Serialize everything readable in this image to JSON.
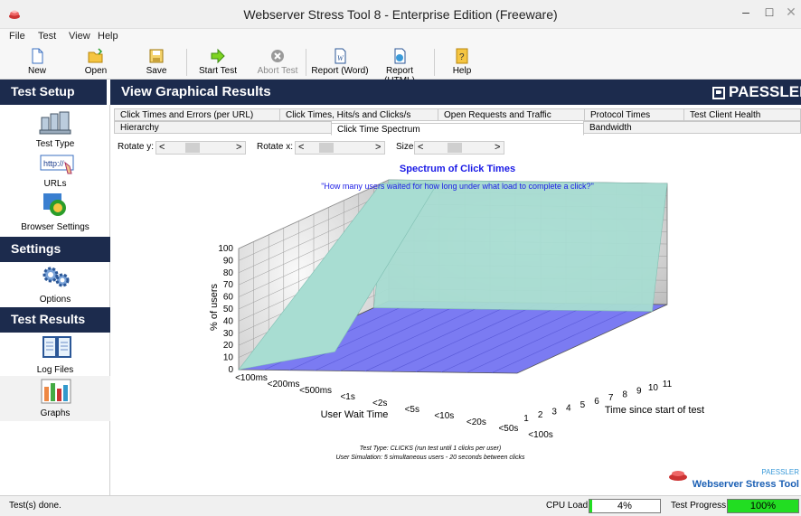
{
  "window": {
    "title": "Webserver Stress Tool 8 - Enterprise Edition (Freeware)"
  },
  "menu": [
    "File",
    "Test",
    "View",
    "Help"
  ],
  "toolbar": {
    "new": "New",
    "open": "Open",
    "save": "Save",
    "start_test": "Start Test",
    "abort_test": "Abort Test",
    "report_word": "Report (Word)",
    "report_html": "Report (HTML)",
    "help": "Help"
  },
  "header": {
    "left": "Test Setup",
    "main": "View Graphical Results",
    "logo": "PAESSLER"
  },
  "sidebar": {
    "test_type": "Test Type",
    "urls": "URLs",
    "browser_settings": "Browser Settings",
    "settings": "Settings",
    "options": "Options",
    "test_results": "Test Results",
    "log_files": "Log Files",
    "graphs": "Graphs",
    "url_icon_text": "http://"
  },
  "tabs": {
    "row1": [
      "Click Times and Errors (per URL)",
      "Click Times, Hits/s and Clicks/s",
      "Open Requests and Traffic",
      "Protocol Times",
      "Test Client Health"
    ],
    "row2": [
      "Hierarchy",
      "Click Time Spectrum",
      "Bandwidth"
    ],
    "active": "Click Time Spectrum"
  },
  "rotate": {
    "rotate_y": "Rotate y:",
    "rotate_x": "Rotate x:",
    "size": "Size:",
    "left": "<",
    "right": ">"
  },
  "chart_data": {
    "type": "area",
    "title": "Spectrum of Click Times",
    "subtitle": "\"How many users waited for how long under what load to complete a click?\"",
    "ylabel": "% of users",
    "xlabel": "User Wait Time",
    "zlabel": "Time since start of test",
    "y_ticks": [
      "0",
      "10",
      "20",
      "30",
      "40",
      "50",
      "60",
      "70",
      "80",
      "90",
      "100"
    ],
    "x_ticks": [
      "<100ms",
      "<200ms",
      "<500ms",
      "<1s",
      "<2s",
      "<5s",
      "<10s",
      "<20s",
      "<50s",
      "<100s"
    ],
    "z_ticks": [
      "1",
      "2",
      "3",
      "4",
      "5",
      "6",
      "7",
      "8",
      "9",
      "10",
      "11"
    ],
    "ylim": [
      0,
      100
    ],
    "series": [
      {
        "values": [
          100,
          0,
          0,
          0,
          0,
          0,
          0,
          0,
          0,
          0
        ],
        "color": "#a8ddd2"
      }
    ],
    "floor_color": "#7b7bf2",
    "footnote1": "Test Type: CLICKS (run test until 1 clicks per user)",
    "footnote2": "User Simulation: 5 simultaneous users - 20 seconds between clicks",
    "brand_small": "PAESSLER",
    "brand_big": "Webserver Stress Tool"
  },
  "status": {
    "left": "Test(s) done.",
    "cpu_label": "CPU Load:",
    "cpu_value": "4%",
    "cpu_fraction": 0.04,
    "progress_label": "Test Progress:",
    "progress_value": "100%",
    "progress_fraction": 1.0
  },
  "colors": {
    "navy": "#1c2b4d",
    "title_blue": "#1a1ae6",
    "progress_green": "#22dd22"
  }
}
